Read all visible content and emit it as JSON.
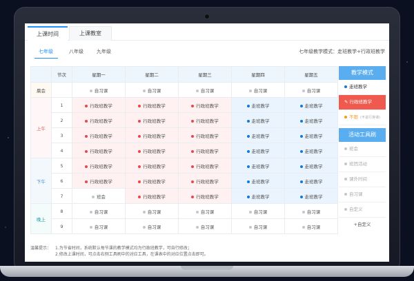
{
  "tabs": {
    "class_time": "上课时间",
    "classroom": "上课教室"
  },
  "grades": [
    "七年级",
    "八年级",
    "九年级"
  ],
  "mode_summary": "七年级教学模式：走班教学+行政班教学",
  "table": {
    "headers": [
      "节次",
      "星期一",
      "星期二",
      "星期三",
      "星期四",
      "星期五"
    ],
    "segments": {
      "morning": "晨会",
      "am": "上午",
      "pm": "下午",
      "evening": "晚上"
    },
    "rows": [
      {
        "num": "",
        "cells": [
          [
            "自习课",
            "gray"
          ],
          [
            "自习课",
            "gray"
          ],
          [
            "自习课",
            "gray"
          ],
          [
            "自习课",
            "gray"
          ],
          [
            "自习课",
            "gray"
          ]
        ]
      },
      {
        "num": "1",
        "cells": [
          [
            "行政班教学",
            "red"
          ],
          [
            "行政班教学",
            "red"
          ],
          [
            "行政班教学",
            "red"
          ],
          [
            "走班教学",
            "blue"
          ],
          [
            "走班教学",
            "blue"
          ]
        ]
      },
      {
        "num": "2",
        "cells": [
          [
            "行政班教学",
            "red"
          ],
          [
            "行政班教学",
            "red"
          ],
          [
            "行政班教学",
            "red"
          ],
          [
            "走班教学",
            "blue"
          ],
          [
            "走班教学",
            "blue"
          ]
        ]
      },
      {
        "num": "3",
        "cells": [
          [
            "行政班教学",
            "red"
          ],
          [
            "行政班教学",
            "red"
          ],
          [
            "行政班教学",
            "red"
          ],
          [
            "走班教学",
            "blue"
          ],
          [
            "走班教学",
            "blue"
          ]
        ]
      },
      {
        "num": "4",
        "cells": [
          [
            "行政班教学",
            "red"
          ],
          [
            "行政班教学",
            "red"
          ],
          [
            "行政班教学",
            "red"
          ],
          [
            "走班教学",
            "blue"
          ],
          [
            "走班教学",
            "blue"
          ]
        ]
      },
      {
        "num": "5",
        "cells": [
          [
            "行政班教学",
            "red"
          ],
          [
            "行政班教学",
            "red"
          ],
          [
            "行政班教学",
            "red"
          ],
          [
            "走班教学",
            "blue"
          ],
          [
            "走班教学",
            "blue"
          ]
        ]
      },
      {
        "num": "6",
        "cells": [
          [
            "行政班教学",
            "red"
          ],
          [
            "行政班教学",
            "red"
          ],
          [
            "行政班教学",
            "red"
          ],
          [
            "走班教学",
            "blue"
          ],
          [
            "走班教学",
            "blue"
          ]
        ]
      },
      {
        "num": "7",
        "cells": [
          [
            "班会",
            "gray"
          ],
          [
            "行政班教学",
            "red"
          ],
          [
            "行政班教学",
            "red"
          ],
          [
            "走班教学",
            "blue"
          ],
          [
            "走班教学",
            "blue"
          ]
        ]
      },
      {
        "num": "8",
        "cells": [
          [
            "自习课",
            "gray"
          ],
          [
            "自习课",
            "gray"
          ],
          [
            "自习课",
            "gray"
          ],
          [
            "自习课",
            "gray"
          ],
          [
            "自习课",
            "gray"
          ]
        ]
      },
      {
        "num": "9",
        "cells": [
          [
            "自习课",
            "gray"
          ],
          [
            "自习课",
            "gray"
          ],
          [
            "自习课",
            "gray"
          ],
          [
            "自习课",
            "gray"
          ],
          [
            "自习课",
            "gray"
          ]
        ]
      }
    ]
  },
  "panel": {
    "mode_title": "教学模式",
    "mode_items": [
      "走班教学",
      "行政班教学"
    ],
    "unlimited": "不限",
    "unlimited_hint": "(不进行排课)",
    "tool_title": "活动工具刷",
    "tool_items": [
      "班会",
      "班团活动",
      "课外时间",
      "自习课",
      "自定义"
    ],
    "custom_add": "+自定义"
  },
  "tips": {
    "label": "温馨提示：",
    "lines": [
      "1.为节省时间，系统默认每节课的教学模式均为行政班教学，可自行修改；",
      "2.修改上课时间，可点击右侧工具刷中的对应工具，在课表中的对应位置点击即可。"
    ]
  },
  "colors": {
    "accent": "#1e90ff",
    "admin_red": "#e8474c",
    "walk_blue": "#1677d9",
    "panel_blue": "#5aaef0"
  }
}
